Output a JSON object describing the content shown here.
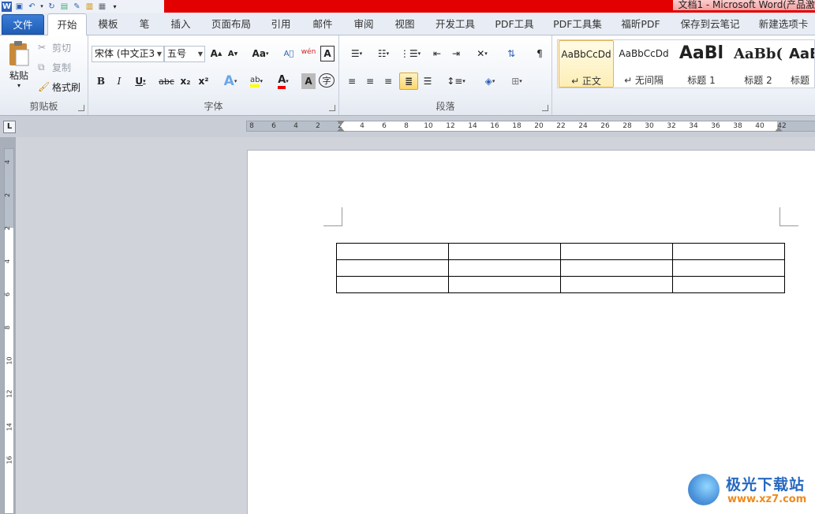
{
  "window": {
    "title": "文档1 - Microsoft Word(产品激"
  },
  "quick_access": [
    "word-icon",
    "save-icon",
    "undo-icon",
    "redo-icon",
    "print-preview-icon",
    "edit-icon",
    "image-icon",
    "table-icon",
    "layout-icon",
    "customize-icon"
  ],
  "tabs": [
    "文件",
    "开始",
    "模板",
    "笔",
    "插入",
    "页面布局",
    "引用",
    "邮件",
    "审阅",
    "视图",
    "开发工具",
    "PDF工具",
    "PDF工具集",
    "福昕PDF",
    "保存到云笔记",
    "新建选项卡"
  ],
  "active_tab": "开始",
  "clipboard": {
    "paste": "粘贴",
    "cut": "剪切",
    "copy": "复制",
    "format_painter": "格式刷",
    "label": "剪贴板"
  },
  "font": {
    "name": "宋体 (中文正3",
    "size": "五号",
    "label": "字体",
    "grow": "A",
    "shrink": "A",
    "case": "Aa",
    "bold": "B",
    "italic": "I",
    "underline": "U",
    "strike": "abc",
    "sub": "x₂",
    "sup": "x²",
    "pinyin": "wén",
    "border_char": "A",
    "enclose": "字"
  },
  "paragraph": {
    "label": "段落"
  },
  "styles": [
    {
      "sample": "AaBbCcDd",
      "name": "↵ 正文"
    },
    {
      "sample": "AaBbCcDd",
      "name": "↵ 无间隔"
    },
    {
      "sample": "AaBl",
      "name": "标题 1"
    },
    {
      "sample": "AaBb(",
      "name": "标题 2"
    },
    {
      "sample": "AaB",
      "name": "标题"
    }
  ],
  "ruler": {
    "h_ticks": [
      "8",
      "6",
      "4",
      "2",
      "2",
      "4",
      "6",
      "8",
      "10",
      "12",
      "14",
      "16",
      "18",
      "20",
      "22",
      "24",
      "26",
      "28",
      "30",
      "32",
      "34",
      "36",
      "38",
      "40",
      "42"
    ],
    "v_ticks": [
      "4",
      "2",
      "2",
      "4",
      "6",
      "8",
      "10",
      "12",
      "14",
      "16"
    ]
  },
  "table": {
    "rows": 3,
    "cols": 4
  },
  "watermark": {
    "title": "极光下载站",
    "url": "www.xz7.com"
  }
}
